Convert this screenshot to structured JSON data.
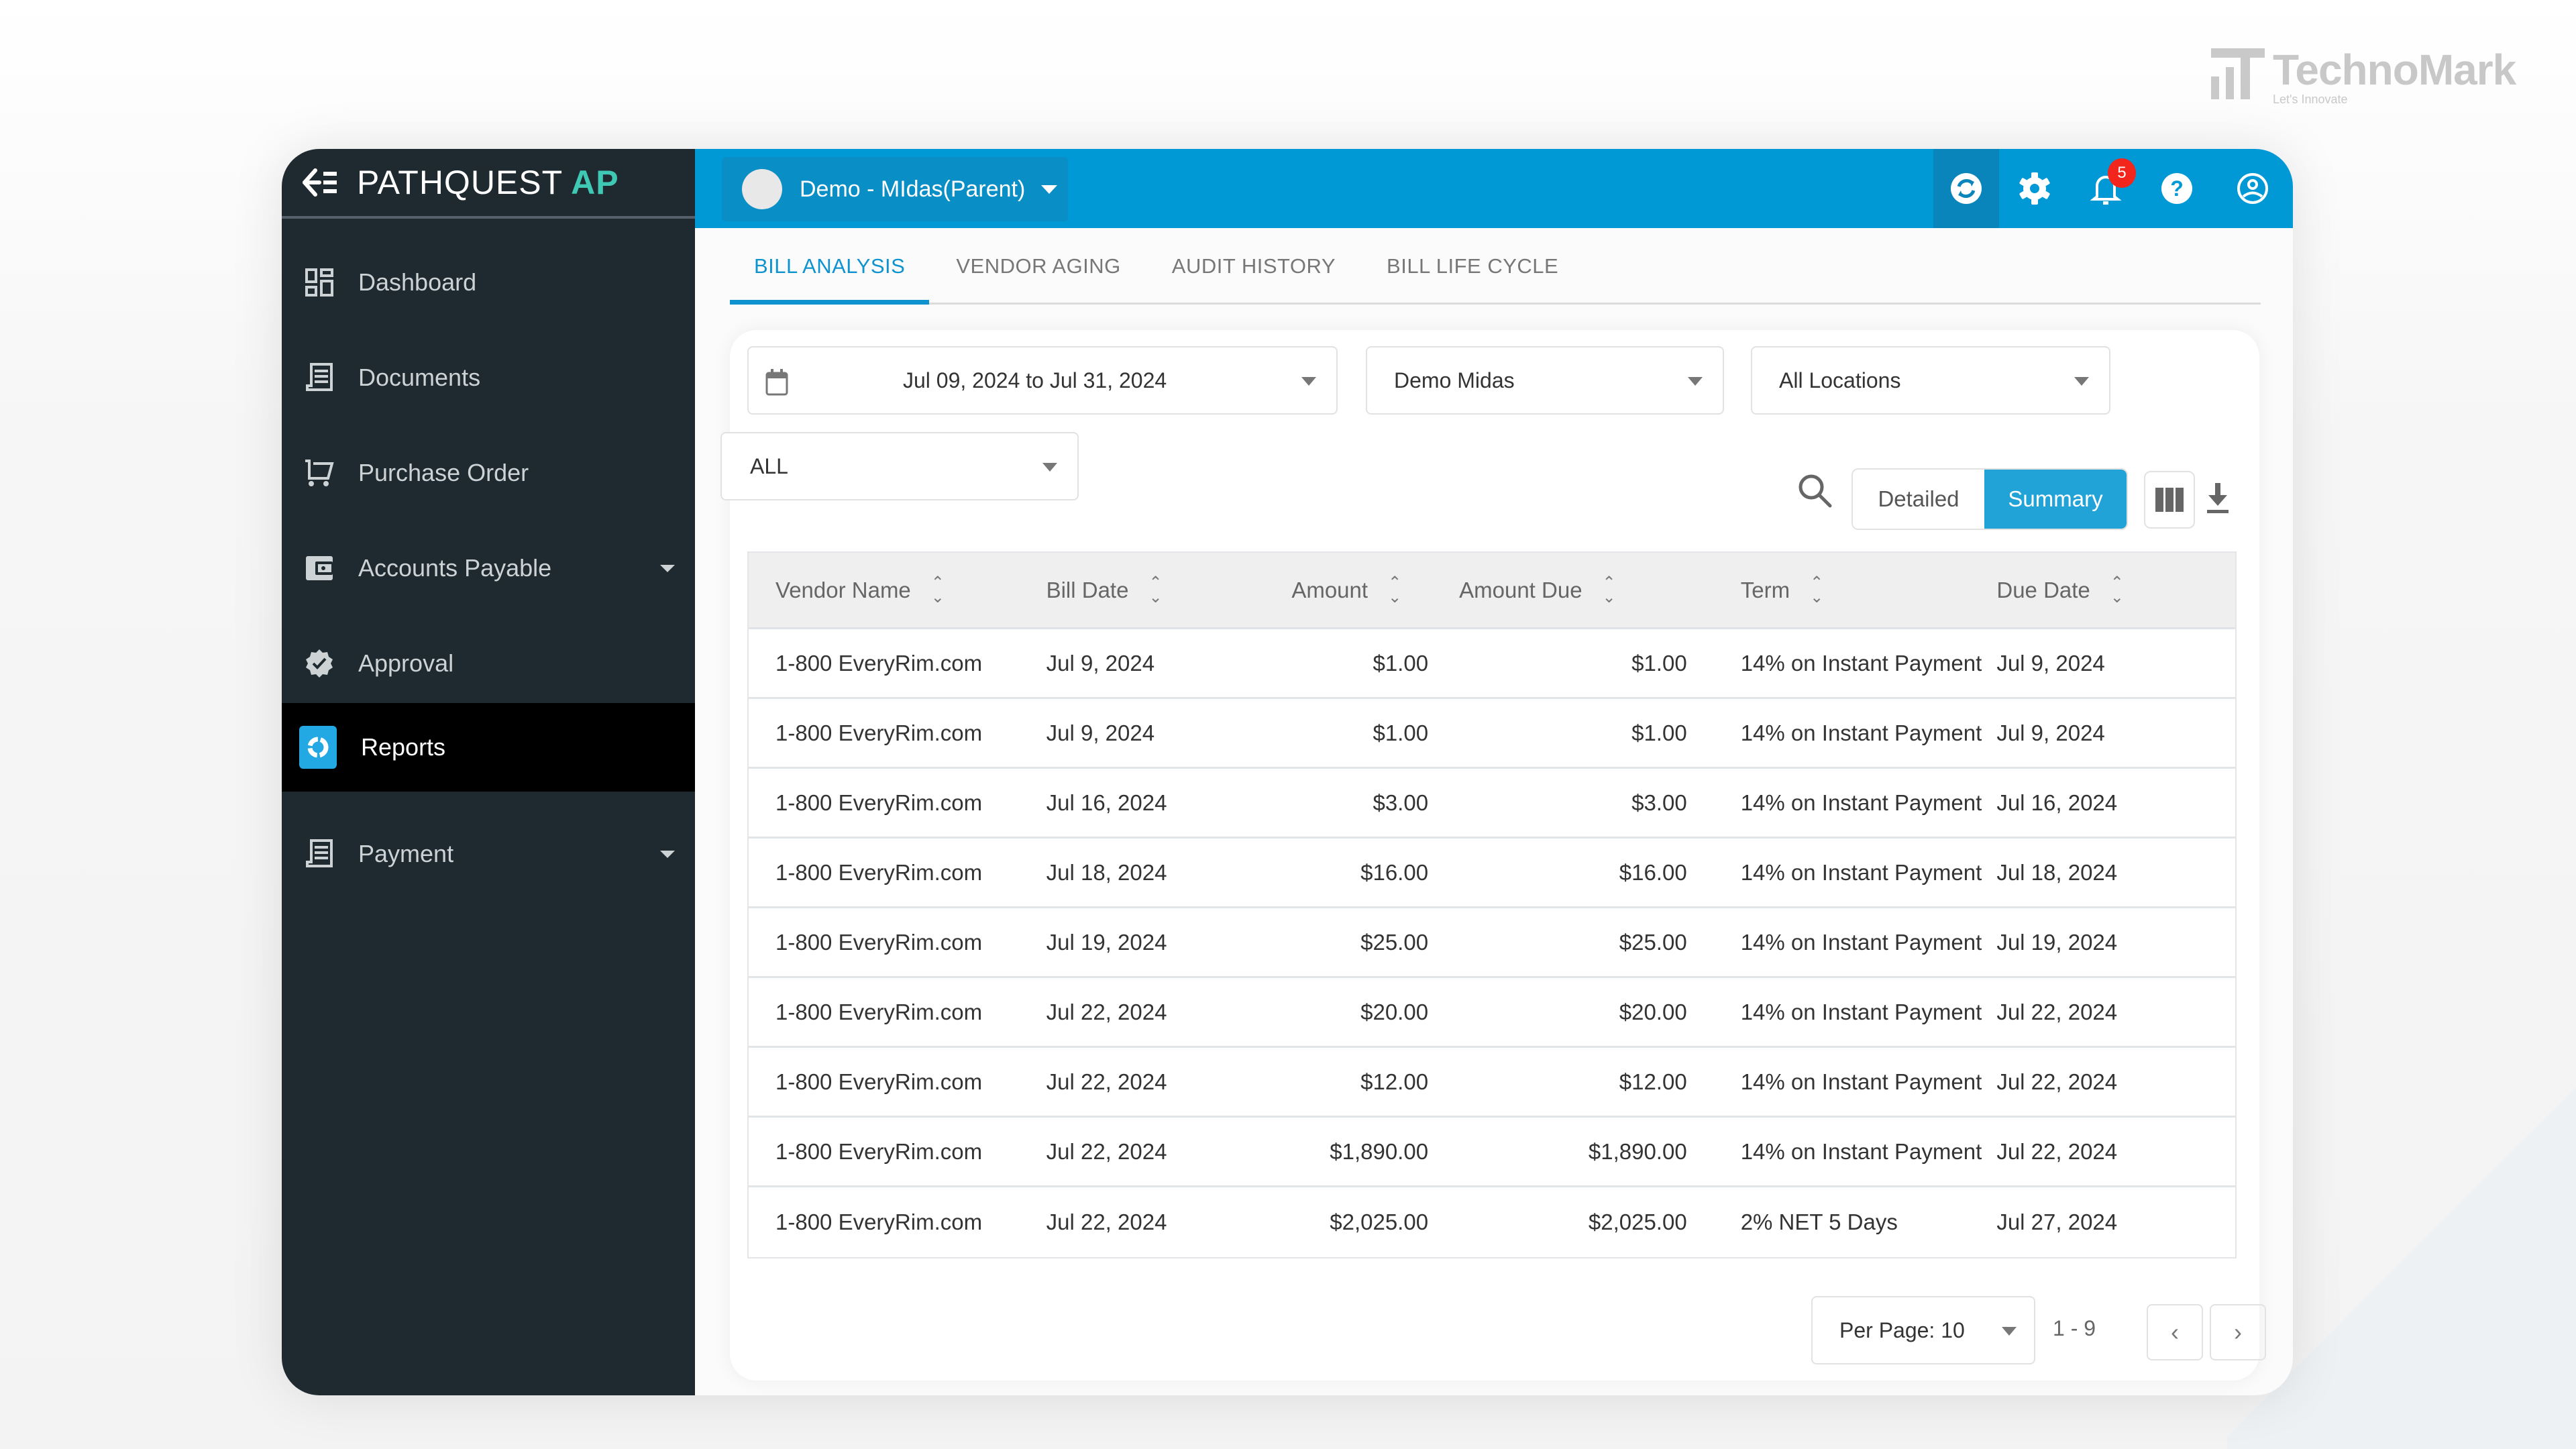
{
  "watermark": {
    "name": "TechnoMark",
    "tagline": "Let's Innovate"
  },
  "sidebar": {
    "logo_main": "PATHQUEST",
    "logo_accent": "AP",
    "items": [
      {
        "label": "Dashboard",
        "icon": "dashboard-icon",
        "has_caret": false
      },
      {
        "label": "Documents",
        "icon": "document-icon",
        "has_caret": false
      },
      {
        "label": "Purchase Order",
        "icon": "cart-icon",
        "has_caret": false
      },
      {
        "label": "Accounts Payable",
        "icon": "wallet-icon",
        "has_caret": true
      },
      {
        "label": "Approval",
        "icon": "approval-badge-icon",
        "has_caret": false
      },
      {
        "label": "Reports",
        "icon": "reports-icon",
        "has_caret": false,
        "active": true
      },
      {
        "label": "Payment",
        "icon": "receipt-icon",
        "has_caret": true
      }
    ]
  },
  "topbar": {
    "org_name": "Demo - MIdas(Parent)",
    "notification_count": "5",
    "icons": [
      "sync-icon",
      "gear-icon",
      "bell-icon",
      "help-icon",
      "user-icon"
    ]
  },
  "tabs": [
    {
      "label": "BILL ANALYSIS",
      "active": true
    },
    {
      "label": "VENDOR AGING"
    },
    {
      "label": "AUDIT HISTORY"
    },
    {
      "label": "BILL LIFE CYCLE"
    }
  ],
  "filters": {
    "date_range": "Jul 09, 2024 to Jul 31, 2024",
    "company": "Demo Midas",
    "location": "All Locations",
    "status": "ALL"
  },
  "view_toggle": {
    "detailed": "Detailed",
    "summary": "Summary",
    "selected": "Summary"
  },
  "table": {
    "columns": [
      "Vendor Name",
      "Bill Date",
      "Amount",
      "Amount Due",
      "Term",
      "Due Date"
    ],
    "rows": [
      [
        "1-800 EveryRim.com",
        "Jul 9, 2024",
        "$1.00",
        "$1.00",
        "14% on Instant Payment",
        "Jul 9, 2024"
      ],
      [
        "1-800 EveryRim.com",
        "Jul 9, 2024",
        "$1.00",
        "$1.00",
        "14% on Instant Payment",
        "Jul 9, 2024"
      ],
      [
        "1-800 EveryRim.com",
        "Jul 16, 2024",
        "$3.00",
        "$3.00",
        "14% on Instant Payment",
        "Jul 16, 2024"
      ],
      [
        "1-800 EveryRim.com",
        "Jul 18, 2024",
        "$16.00",
        "$16.00",
        "14% on Instant Payment",
        "Jul 18, 2024"
      ],
      [
        "1-800 EveryRim.com",
        "Jul 19, 2024",
        "$25.00",
        "$25.00",
        "14% on Instant Payment",
        "Jul 19, 2024"
      ],
      [
        "1-800 EveryRim.com",
        "Jul 22, 2024",
        "$20.00",
        "$20.00",
        "14% on Instant Payment",
        "Jul 22, 2024"
      ],
      [
        "1-800 EveryRim.com",
        "Jul 22, 2024",
        "$12.00",
        "$12.00",
        "14% on Instant Payment",
        "Jul 22, 2024"
      ],
      [
        "1-800 EveryRim.com",
        "Jul 22, 2024",
        "$1,890.00",
        "$1,890.00",
        "14% on Instant Payment",
        "Jul 22, 2024"
      ],
      [
        "1-800 EveryRim.com",
        "Jul 22, 2024",
        "$2,025.00",
        "$2,025.00",
        "2% NET 5 Days",
        "Jul 27, 2024"
      ]
    ]
  },
  "pagination": {
    "per_page": "Per Page: 10",
    "range": "1 - 9",
    "prev": "‹",
    "next": "›"
  },
  "colors": {
    "accent": "#0099d6",
    "sidebar": "#1f2a30",
    "badge": "#f2261c",
    "logo_accent": "#3fc9b5"
  }
}
